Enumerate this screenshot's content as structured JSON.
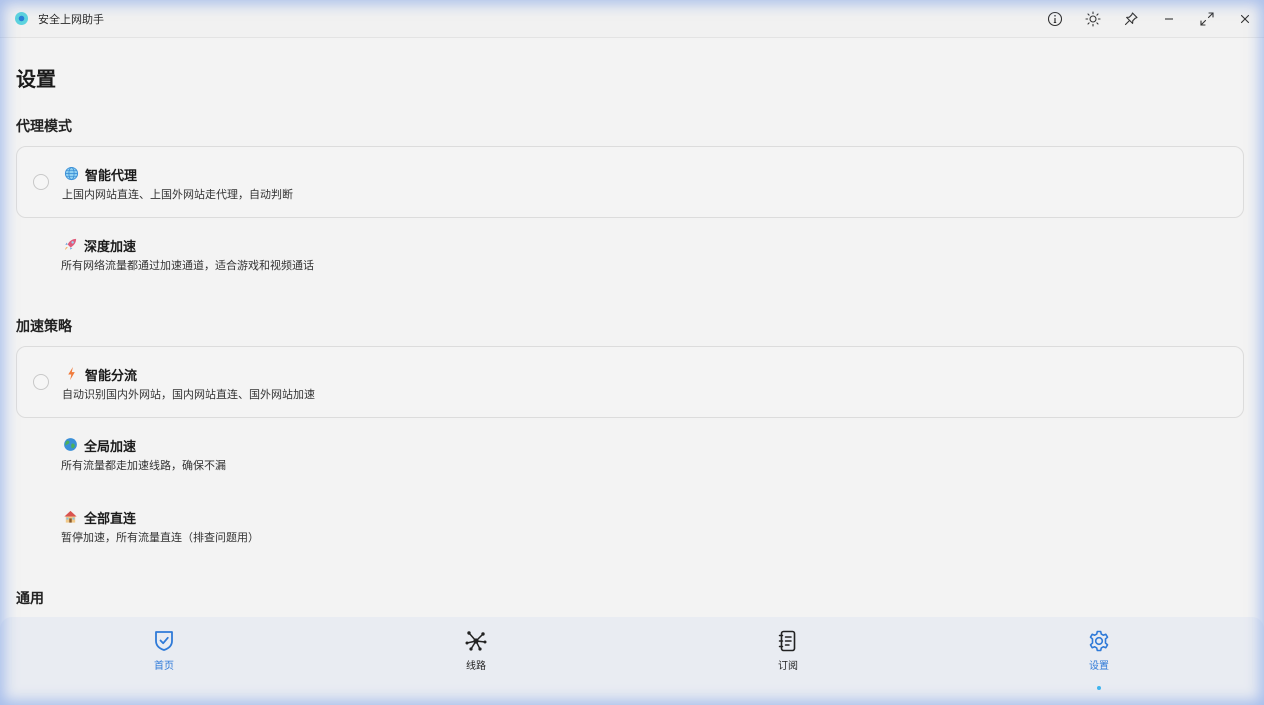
{
  "window": {
    "title": "安全上网助手",
    "controls": [
      "info-icon",
      "theme-sun-icon",
      "pin-icon",
      "minimize-icon",
      "maximize-icon",
      "close-icon"
    ]
  },
  "page": {
    "title": "设置"
  },
  "sections": {
    "proxy_mode": {
      "title": "代理模式",
      "options": [
        {
          "icon": "globe-icon",
          "title": "智能代理",
          "desc": "上国内网站直连、上国外网站走代理，自动判断",
          "selected": true
        },
        {
          "icon": "rocket-icon",
          "title": "深度加速",
          "desc": "所有网络流量都通过加速通道，适合游戏和视频通话",
          "selected": false
        }
      ]
    },
    "strategy": {
      "title": "加速策略",
      "options": [
        {
          "icon": "lightning-icon",
          "title": "智能分流",
          "desc": "自动识别国内外网站，国内网站直连、国外网站加速",
          "selected": true
        },
        {
          "icon": "earth-icon",
          "title": "全局加速",
          "desc": "所有流量都走加速线路，确保不漏",
          "selected": false
        },
        {
          "icon": "house-icon",
          "title": "全部直连",
          "desc": "暂停加速，所有流量直连（排查问题用）",
          "selected": false
        }
      ]
    },
    "general": {
      "title": "通用"
    }
  },
  "nav": {
    "items": [
      {
        "icon": "shield-check-icon",
        "label": "首页",
        "active": false
      },
      {
        "icon": "network-nodes-icon",
        "label": "线路",
        "active": false
      },
      {
        "icon": "notebook-icon",
        "label": "订阅",
        "active": false
      },
      {
        "icon": "gear-icon",
        "label": "设置",
        "active": true
      }
    ]
  },
  "colors": {
    "accent": "#2f7ad8",
    "indicator": "#3fb6ee",
    "background": "#f3f3f3",
    "nav_background": "#e9ecf2"
  }
}
